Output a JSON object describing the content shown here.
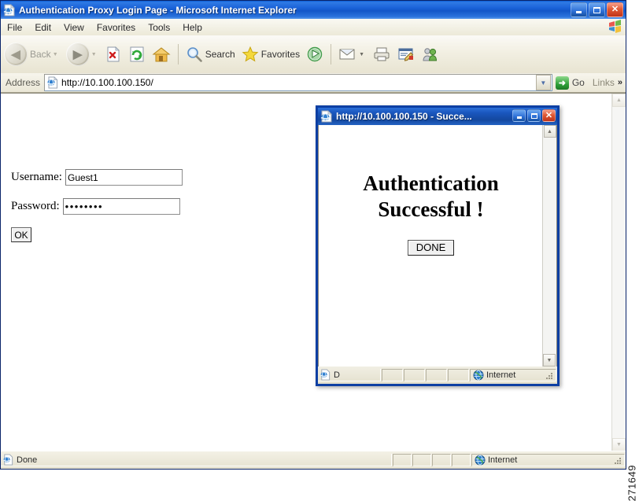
{
  "main_window": {
    "title": "Authentication Proxy Login Page - Microsoft Internet Explorer",
    "icon": "ie-document-icon",
    "caption_buttons": {
      "minimize": "minimize-button",
      "maximize": "maximize-button",
      "close": "close-button"
    },
    "menu": [
      {
        "label": "File"
      },
      {
        "label": "Edit"
      },
      {
        "label": "View"
      },
      {
        "label": "Favorites"
      },
      {
        "label": "Tools"
      },
      {
        "label": "Help"
      }
    ],
    "brand_icon": "windows-flag-icon",
    "toolbar": {
      "back_label": "Back",
      "forward_label": "",
      "stop_label": "",
      "refresh_label": "",
      "home_label": "",
      "search_label": "Search",
      "favorites_label": "Favorites",
      "media_label": "",
      "mail_label": "",
      "print_label": "",
      "edit_label": "",
      "messenger_label": ""
    },
    "address_bar": {
      "label": "Address",
      "url": "http://10.100.100.150/",
      "icon": "ie-page-icon",
      "go_label": "Go",
      "links_label": "Links"
    },
    "status_bar": {
      "message": "Done",
      "zone": "Internet",
      "zone_icon": "globe-icon",
      "page_icon": "ie-document-icon"
    }
  },
  "login_form": {
    "username": {
      "label": "Username:",
      "value": "Guest1"
    },
    "password": {
      "label": "Password:",
      "value": "••••••••"
    },
    "submit_label": "OK"
  },
  "popup_window": {
    "title": "http://10.100.100.150 - Succe...",
    "icon": "ie-document-icon",
    "caption_buttons": {
      "minimize": "minimize-button",
      "maximize": "maximize-button",
      "close": "close-button"
    },
    "message_line1": "Authentication",
    "message_line2": "Successful !",
    "done_label": "DONE",
    "status_bar": {
      "message": "D",
      "zone": "Internet",
      "zone_icon": "globe-icon",
      "page_icon": "ie-document-icon"
    }
  },
  "figure": {
    "number": "271649"
  },
  "colors": {
    "title_blue": "#1256c8",
    "popup_border": "#0d3fa3",
    "chrome_beige": "#ece9d8",
    "close_red": "#c0341a",
    "go_green": "#2f9f38"
  }
}
